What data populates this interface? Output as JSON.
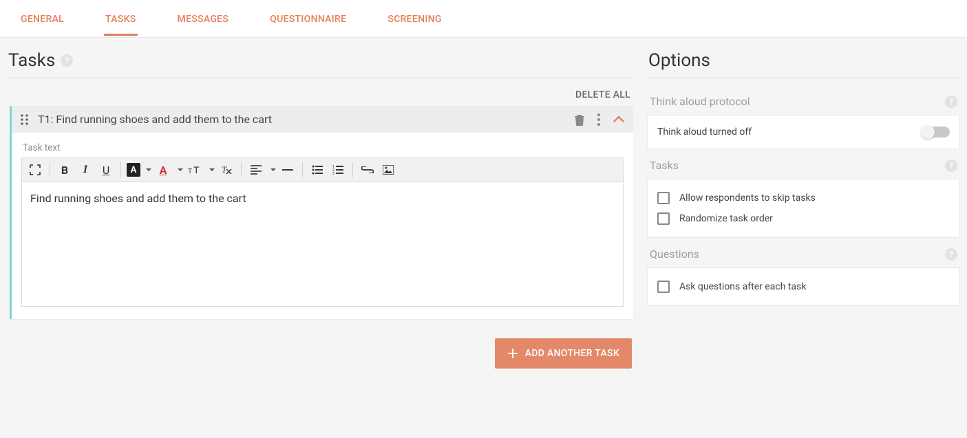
{
  "tabs": {
    "general": "GENERAL",
    "tasks": "TASKS",
    "messages": "MESSAGES",
    "questionnaire": "QUESTIONNAIRE",
    "screening": "SCREENING",
    "active": "tasks"
  },
  "left": {
    "heading": "Tasks",
    "delete_all": "DELETE ALL",
    "task": {
      "header": "T1: Find running shoes and add them to the cart",
      "field_label": "Task text",
      "content": "Find running shoes and add them to the cart"
    },
    "add_button": "ADD ANOTHER TASK"
  },
  "right": {
    "heading": "Options",
    "think_aloud": {
      "title": "Think aloud protocol",
      "status_text": "Think aloud turned off",
      "on": false
    },
    "tasks_group": {
      "title": "Tasks",
      "allow_skip": "Allow respondents to skip tasks",
      "randomize": "Randomize task order"
    },
    "questions_group": {
      "title": "Questions",
      "ask_after": "Ask questions after each task"
    }
  }
}
